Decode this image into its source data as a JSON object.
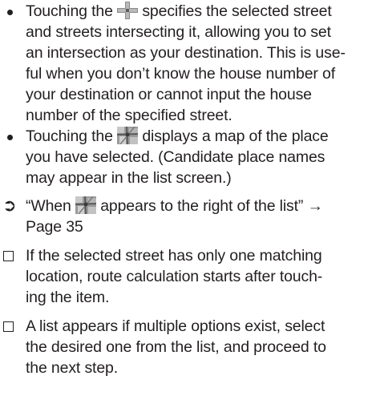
{
  "bullets": [
    {
      "lines": [
        {
          "before": "Touching the ",
          "icon": "cross-intersection-icon",
          "after": " specifies the selected street"
        },
        {
          "text": "and streets intersecting it, allowing you to set"
        },
        {
          "text": "an intersection as your destination. This is use-"
        },
        {
          "text": "ful when you don’t know the house number of"
        },
        {
          "text": "your destination or cannot input the house"
        },
        {
          "text": "number of the specified street."
        }
      ]
    },
    {
      "lines": [
        {
          "before": "Touching the ",
          "icon": "map-icon",
          "after": " displays a map of the place"
        },
        {
          "text": "you have selected. (Candidate place names"
        },
        {
          "text": "may appear in the list screen.)"
        }
      ]
    }
  ],
  "reference": {
    "marker": "➲",
    "line1_before": "“When ",
    "icon": "map-icon",
    "line1_after": " appears to the right of the list” →",
    "line2": "Page 35"
  },
  "notes": [
    {
      "lines": [
        "If the selected street has only one matching",
        "location, route calculation starts after touch-",
        "ing the item."
      ]
    },
    {
      "lines": [
        "A list appears if multiple options exist, select",
        "the desired one from the list, and proceed to",
        "the next step."
      ]
    }
  ]
}
